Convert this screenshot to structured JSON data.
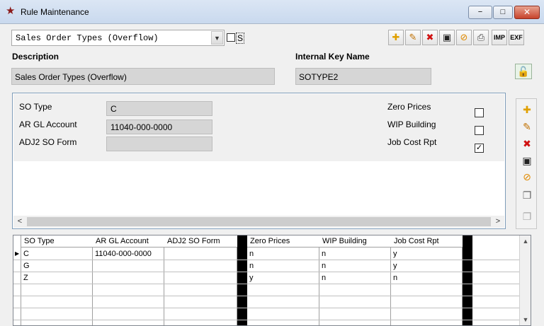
{
  "window": {
    "title": "Rule Maintenance",
    "icon": "star-icon",
    "minimize": "−",
    "maximize": "□",
    "close": "✕"
  },
  "selector": {
    "value": "Sales Order Types (Overflow)",
    "s_label": "S"
  },
  "toolbar": {
    "imp": "IMP",
    "exf": "EXF"
  },
  "header": {
    "description_label": "Description",
    "description_value": "Sales Order Types (Overflow)",
    "key_label": "Internal Key Name",
    "key_value": "SOTYPE2"
  },
  "detail": {
    "so_type_label": "SO Type",
    "so_type_value": "C",
    "ar_gl_label": "AR GL Account",
    "ar_gl_value": "11040-000-0000",
    "adj2_label": "ADJ2 SO Form",
    "adj2_value": "",
    "zero_prices_label": "Zero Prices",
    "zero_prices_checked": false,
    "wip_label": "WIP Building",
    "wip_checked": false,
    "jobcost_label": "Job Cost Rpt",
    "jobcost_checked": true
  },
  "grid": {
    "columns": [
      "SO Type",
      "AR GL Account",
      "ADJ2 SO Form",
      "Zero Prices",
      "WIP Building",
      "Job Cost Rpt"
    ],
    "rows": [
      {
        "so_type": "C",
        "ar_gl": "11040-000-0000",
        "adj2": "",
        "zero": "n",
        "wip": "n",
        "jobcost": "y"
      },
      {
        "so_type": "G",
        "ar_gl": "",
        "adj2": "",
        "zero": "n",
        "wip": "n",
        "jobcost": "y"
      },
      {
        "so_type": "Z",
        "ar_gl": "",
        "adj2": "",
        "zero": "y",
        "wip": "n",
        "jobcost": "n"
      }
    ]
  }
}
